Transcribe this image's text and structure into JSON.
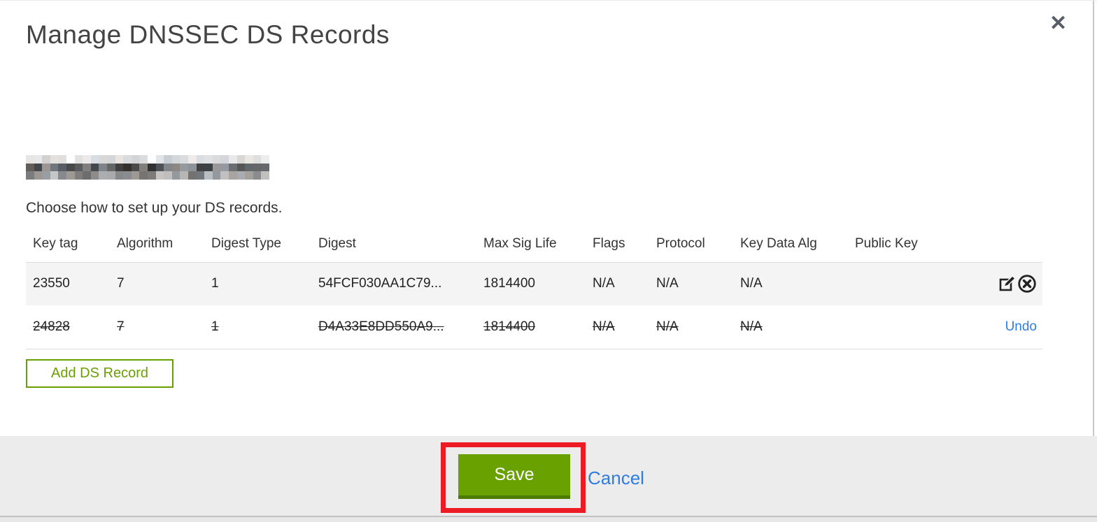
{
  "dialog": {
    "title": "Manage DNSSEC DS Records",
    "close_label": "✕",
    "instruction": "Choose how to set up your DS records."
  },
  "table": {
    "columns": [
      "Key tag",
      "Algorithm",
      "Digest Type",
      "Digest",
      "Max Sig Life",
      "Flags",
      "Protocol",
      "Key Data Alg",
      "Public Key"
    ],
    "rows": [
      {
        "cells": [
          "23550",
          "7",
          "1",
          "54FCF030AA1C79...",
          "1814400",
          "N/A",
          "N/A",
          "N/A",
          ""
        ],
        "deleted": false
      },
      {
        "cells": [
          "24828",
          "7",
          "1",
          "D4A33E8DD550A9...",
          "1814400",
          "N/A",
          "N/A",
          "N/A",
          ""
        ],
        "deleted": true,
        "undo_label": "Undo"
      }
    ]
  },
  "buttons": {
    "add_ds_record": "Add DS Record",
    "save": "Save",
    "cancel": "Cancel"
  },
  "icons": {
    "edit": "edit-record-icon",
    "delete": "delete-record-icon"
  },
  "colors": {
    "accent_green": "#69a200",
    "outline_green": "#6a9f00",
    "link_blue": "#2e7de1",
    "annotation_red": "#ed1c24"
  }
}
